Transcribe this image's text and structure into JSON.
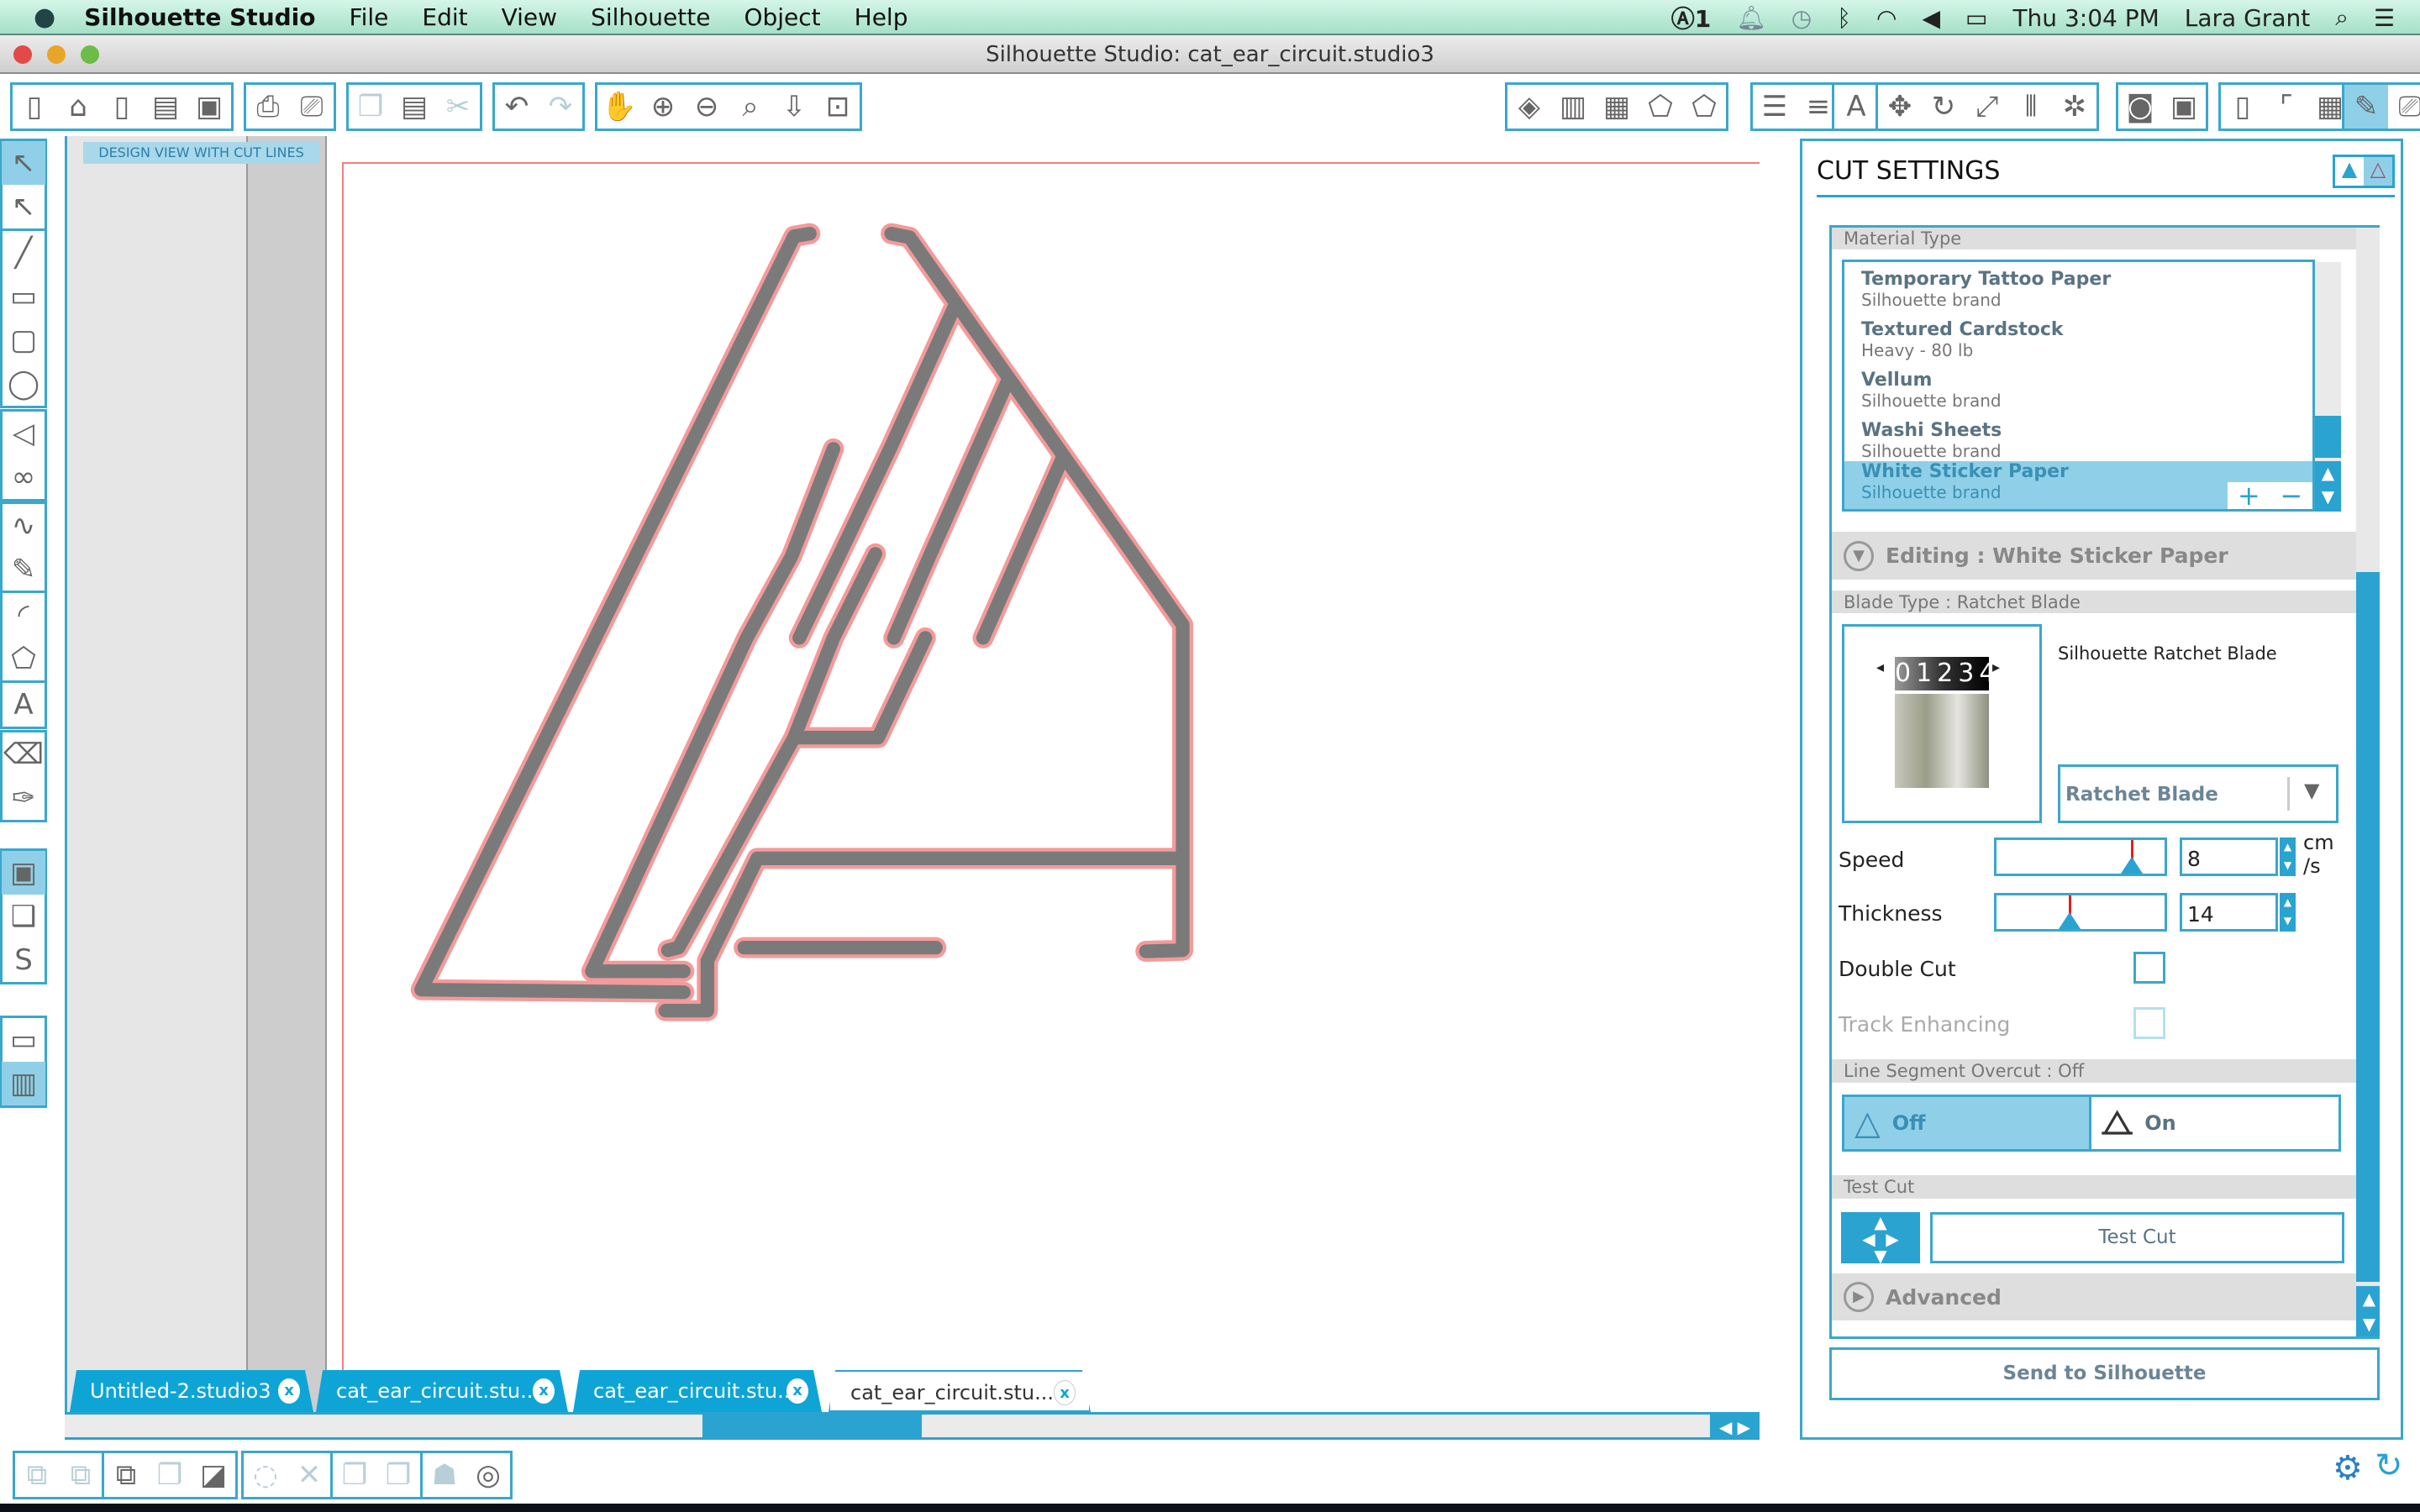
{
  "menubar": {
    "app": "Silhouette Studio",
    "items": [
      "File",
      "Edit",
      "View",
      "Silhouette",
      "Object",
      "Help"
    ],
    "status": {
      "adobe_count": "1",
      "clock": "Thu 3:04 PM",
      "user": "Lara Grant"
    }
  },
  "window": {
    "title": "Silhouette Studio: cat_ear_circuit.studio3"
  },
  "toolbar_left": [
    [
      {
        "n": "new-document",
        "g": "▯"
      },
      {
        "n": "open-folder",
        "g": "⌂"
      },
      {
        "n": "template",
        "g": "▯"
      },
      {
        "n": "save",
        "g": "▤"
      },
      {
        "n": "save-to-library",
        "g": "▣"
      }
    ],
    [
      {
        "n": "print",
        "g": "⎙"
      },
      {
        "n": "print-and-cut",
        "g": "⎚"
      }
    ],
    [
      {
        "n": "copy",
        "g": "❐",
        "d": 1
      },
      {
        "n": "paste",
        "g": "▤"
      },
      {
        "n": "cut-scissors",
        "g": "✂",
        "d": 1
      }
    ],
    [
      {
        "n": "undo",
        "g": "↶"
      },
      {
        "n": "redo",
        "g": "↷",
        "d": 1
      }
    ],
    [
      {
        "n": "pan-hand",
        "g": "✋"
      },
      {
        "n": "zoom-in",
        "g": "⊕"
      },
      {
        "n": "zoom-out",
        "g": "⊖"
      },
      {
        "n": "zoom-select",
        "g": "⌕"
      },
      {
        "n": "drag-zoom",
        "g": "⇩"
      },
      {
        "n": "fit-to-page",
        "g": "⊡"
      }
    ]
  ],
  "toolbar_right": [
    [
      {
        "n": "fill-color",
        "g": "◈"
      },
      {
        "n": "fill-gradient",
        "g": "▥"
      },
      {
        "n": "fill-pattern",
        "g": "▦"
      },
      {
        "n": "line-color",
        "g": "⬠"
      },
      {
        "n": "line-style",
        "g": "⬠"
      }
    ],
    [
      {
        "n": "line-colors",
        "g": "☰"
      },
      {
        "n": "line-types",
        "g": "≡"
      }
    ],
    [
      {
        "n": "text-style",
        "g": "A"
      }
    ],
    [
      {
        "n": "transform",
        "g": "✥"
      },
      {
        "n": "rotate",
        "g": "↻"
      },
      {
        "n": "scale",
        "g": "⤢"
      },
      {
        "n": "align",
        "g": "⫴"
      },
      {
        "n": "replicate",
        "g": "✲"
      }
    ],
    [
      {
        "n": "modify",
        "g": "◙"
      },
      {
        "n": "offset",
        "g": "▣"
      }
    ],
    [
      {
        "n": "page-settings",
        "g": "▯"
      },
      {
        "n": "registration-marks",
        "g": "⌜"
      },
      {
        "n": "grid",
        "g": "▦"
      }
    ],
    [
      {
        "n": "cut-settings",
        "g": "✎",
        "a": 1
      },
      {
        "n": "send-to-cutter",
        "g": "⎚"
      }
    ]
  ],
  "toolbar_side": [
    [
      {
        "n": "select-tool",
        "g": "↖",
        "a": 1
      },
      {
        "n": "point-edit",
        "g": "↖"
      }
    ],
    [
      {
        "n": "line-tool",
        "g": "╱"
      },
      {
        "n": "rectangle-tool",
        "g": "▭"
      },
      {
        "n": "rounded-rectangle-tool",
        "g": "▢"
      },
      {
        "n": "ellipse-tool",
        "g": "◯"
      }
    ],
    [
      {
        "n": "polygon-tool",
        "g": "◁"
      },
      {
        "n": "curve-tool",
        "g": "∞"
      }
    ],
    [
      {
        "n": "freehand-tool",
        "g": "∿"
      },
      {
        "n": "smooth-freehand-tool",
        "g": "✎"
      }
    ],
    [
      {
        "n": "arc-tool",
        "g": "◜"
      },
      {
        "n": "regular-polygon-tool",
        "g": "⬠"
      }
    ],
    [
      {
        "n": "text-tool",
        "g": "A"
      }
    ],
    [
      {
        "n": "eraser-tool",
        "g": "⌫"
      },
      {
        "n": "knife-tool",
        "g": "✑"
      }
    ],
    [
      {
        "n": "design-view",
        "g": "▣",
        "a": 1
      },
      {
        "n": "library",
        "g": "❑"
      },
      {
        "n": "online-store",
        "g": "S"
      }
    ],
    [
      {
        "n": "single-view",
        "g": "▭"
      },
      {
        "n": "split-view",
        "g": "▥",
        "a": 1
      }
    ]
  ],
  "toolbar_bottom": [
    [
      {
        "n": "group",
        "g": "⧉",
        "d": 1
      },
      {
        "n": "ungroup",
        "g": "⧉",
        "d": 1
      }
    ],
    [
      {
        "n": "make-compound-path",
        "g": "⧉"
      },
      {
        "n": "release-compound-path",
        "g": "❐",
        "d": 1
      },
      {
        "n": "bring-to-front",
        "g": "◪"
      }
    ],
    [
      {
        "n": "weld",
        "g": "◌",
        "d": 1
      },
      {
        "n": "delete",
        "g": "✕",
        "d": 1
      }
    ],
    [
      {
        "n": "bring-forward",
        "g": "❐",
        "d": 1
      },
      {
        "n": "send-backward",
        "g": "❐",
        "d": 1
      }
    ],
    [
      {
        "n": "send-to-back",
        "g": "☗",
        "d": 1
      },
      {
        "n": "trace",
        "g": "◎"
      }
    ]
  ],
  "canvas": {
    "view_label": "DESIGN VIEW WITH CUT LINES",
    "cut_line_color": "#f49a9a",
    "shape_color": "#7a7a7a"
  },
  "tabs": [
    {
      "label": "Untitled-2.studio3",
      "active": false
    },
    {
      "label": "cat_ear_circuit.stu...",
      "active": false
    },
    {
      "label": "cat_ear_circuit.stu...",
      "active": false
    },
    {
      "label": "cat_ear_circuit.stu...",
      "active": true
    }
  ],
  "tab_close": "x",
  "cut_settings": {
    "title": "CUT SETTINGS",
    "material_header": "Material Type",
    "materials": [
      {
        "name": "Temporary Tattoo Paper",
        "sub": "Silhouette brand"
      },
      {
        "name": "Textured Cardstock",
        "sub": "Heavy - 80 lb"
      },
      {
        "name": "Vellum",
        "sub": "Silhouette brand"
      },
      {
        "name": "Washi Sheets",
        "sub": "Silhouette brand"
      },
      {
        "name": "White Sticker Paper",
        "sub": "Silhouette brand",
        "selected": true
      }
    ],
    "add": "+",
    "remove": "−",
    "editing_header": "Editing : White Sticker Paper",
    "blade_header": "Blade Type : Ratchet Blade",
    "blade_name": "Silhouette Ratchet Blade",
    "blade_dial": "01234",
    "blade_select": "Ratchet Blade",
    "speed": {
      "label": "Speed",
      "value": "8",
      "unit_1": "cm",
      "unit_2": "/s",
      "fraction": 0.8
    },
    "thickness": {
      "label": "Thickness",
      "value": "14",
      "fraction": 0.43
    },
    "double_cut": {
      "label": "Double Cut",
      "checked": false
    },
    "track_enhancing": {
      "label": "Track Enhancing",
      "checked": false,
      "disabled": true
    },
    "overcut_header": "Line Segment Overcut : Off",
    "overcut_off": "Off",
    "overcut_on": "On",
    "test_header": "Test Cut",
    "test_button": "Test Cut",
    "advanced": "Advanced",
    "send": "Send to Silhouette"
  },
  "colors": {
    "accent": "#2aa3d0",
    "selection": "#8fd0e8",
    "tab": "#0ea5d6"
  }
}
